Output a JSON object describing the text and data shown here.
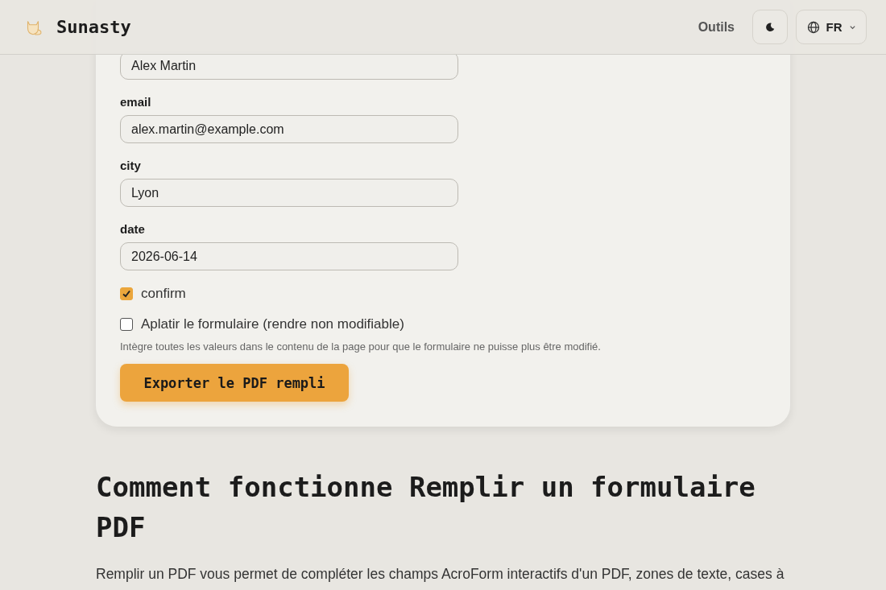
{
  "header": {
    "brand": "Sunasty",
    "nav_link": "Outils",
    "language": "FR"
  },
  "form": {
    "fields": [
      {
        "value": "Alex Martin"
      },
      {
        "label": "email",
        "value": "alex.martin@example.com"
      },
      {
        "label": "city",
        "value": "Lyon"
      },
      {
        "label": "date",
        "value": "2026-06-14"
      }
    ],
    "checkboxes": [
      {
        "label": "confirm",
        "checked": true
      },
      {
        "label": "Aplatir le formulaire (rendre non modifiable)",
        "checked": false
      }
    ],
    "hint": "Intègre toutes les valeurs dans le contenu de la page pour que le formulaire ne puisse plus être modifié.",
    "export_button": "Exporter le PDF rempli"
  },
  "article": {
    "heading": "Comment fonctionne Remplir un formulaire PDF",
    "paragraph": "Remplir un PDF vous permet de compléter les champs AcroForm interactifs d'un PDF, zones de texte, cases à"
  }
}
